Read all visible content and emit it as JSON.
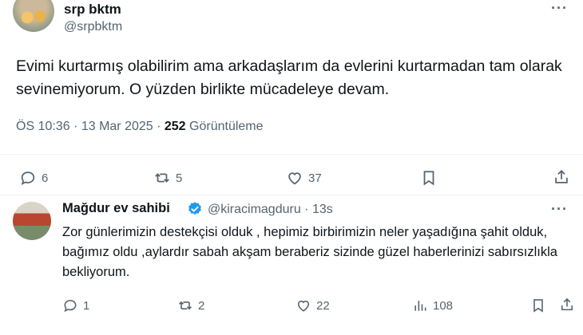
{
  "main_tweet": {
    "author_name": "srp bktm",
    "author_handle": "@srpbktm",
    "more_label": "···",
    "text": "Evimi kurtarmış olabilirim ama arkadaşlarım da evlerini kurtarmadan tam olarak sevinemiyorum. O yüzden birlikte mücadeleye devam.",
    "time": "ÖS 10:36 · 13 Mar 2025 · ",
    "views_count": "252",
    "views_label": " Görüntüleme",
    "actions": {
      "replies": "6",
      "retweets": "5",
      "likes": "37"
    }
  },
  "reply_tweet": {
    "author_name": "Mağdur ev sahibi",
    "author_handle": "@kiracimagduru · 13s",
    "more_label": "···",
    "text": "Zor günlerimizin destekçisi olduk , hepimiz birbirimizin neler yaşadığına şahit olduk, bağımız oldu ,aylardır sabah akşam beraberiz sizinde güzel haberlerinizi sabırsızlıkla bekliyorum.",
    "actions": {
      "replies": "1",
      "retweets": "2",
      "likes": "22",
      "views": "108"
    }
  },
  "colors": {
    "text": "#0f1419",
    "secondary": "#536471",
    "verified": "#1d9bf0",
    "divider": "#eff3f4"
  }
}
